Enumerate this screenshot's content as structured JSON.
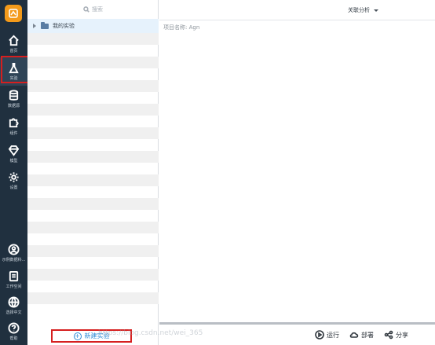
{
  "nav": {
    "items": [
      {
        "label": "首页",
        "icon": "home-icon"
      },
      {
        "label": "实验",
        "icon": "flask-icon"
      },
      {
        "label": "数据源",
        "icon": "database-icon"
      },
      {
        "label": "组件",
        "icon": "puzzle-icon"
      },
      {
        "label": "模型",
        "icon": "diamond-icon"
      },
      {
        "label": "设置",
        "icon": "gear-icon"
      }
    ],
    "bottom_items": [
      {
        "label": "示例数据科...",
        "icon": "user-icon"
      },
      {
        "label": "工作空间",
        "icon": "document-icon"
      },
      {
        "label": "选择中文",
        "icon": "globe-icon"
      },
      {
        "label": "帮助",
        "icon": "help-icon"
      }
    ]
  },
  "tree": {
    "search_placeholder": "搜索",
    "root_folder": "我的实验",
    "new_button": "新建实验"
  },
  "main": {
    "relate_dropdown": "关联分析",
    "project_label": "项目名称: Agn",
    "actions": {
      "run": "运行",
      "deploy": "部署",
      "share": "分享"
    }
  },
  "watermark": "https://blog.csdn.net/wei_365",
  "colors": {
    "rail": "#20303f",
    "logo": "#f39a1a",
    "highlight": "#d61f1f",
    "selected_row": "#e6f2fc",
    "link": "#2e8ad6"
  }
}
